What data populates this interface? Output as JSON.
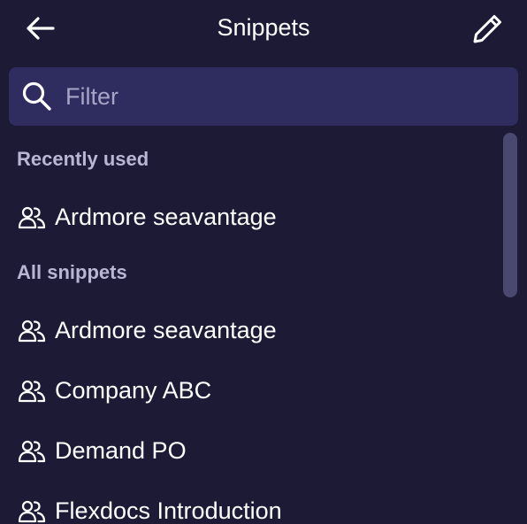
{
  "header": {
    "title": "Snippets",
    "back_icon": "arrow-left-icon",
    "edit_icon": "pencil-icon"
  },
  "filter": {
    "placeholder": "Filter",
    "value": "",
    "icon": "search-icon"
  },
  "sections": {
    "recent": {
      "title": "Recently used",
      "items": [
        {
          "label": "Ardmore seavantage",
          "icon": "users-icon"
        }
      ]
    },
    "all": {
      "title": "All snippets",
      "items": [
        {
          "label": "Ardmore seavantage",
          "icon": "users-icon"
        },
        {
          "label": "Company ABC",
          "icon": "users-icon"
        },
        {
          "label": "Demand PO",
          "icon": "users-icon"
        },
        {
          "label": "Flexdocs Introduction",
          "icon": "users-icon"
        }
      ]
    }
  },
  "colors": {
    "background": "#1c1a35",
    "filter_background": "#2f2c60",
    "section_header": "#b9b6d3",
    "text": "#ffffff",
    "scrollbar_thumb": "#4b4870"
  }
}
